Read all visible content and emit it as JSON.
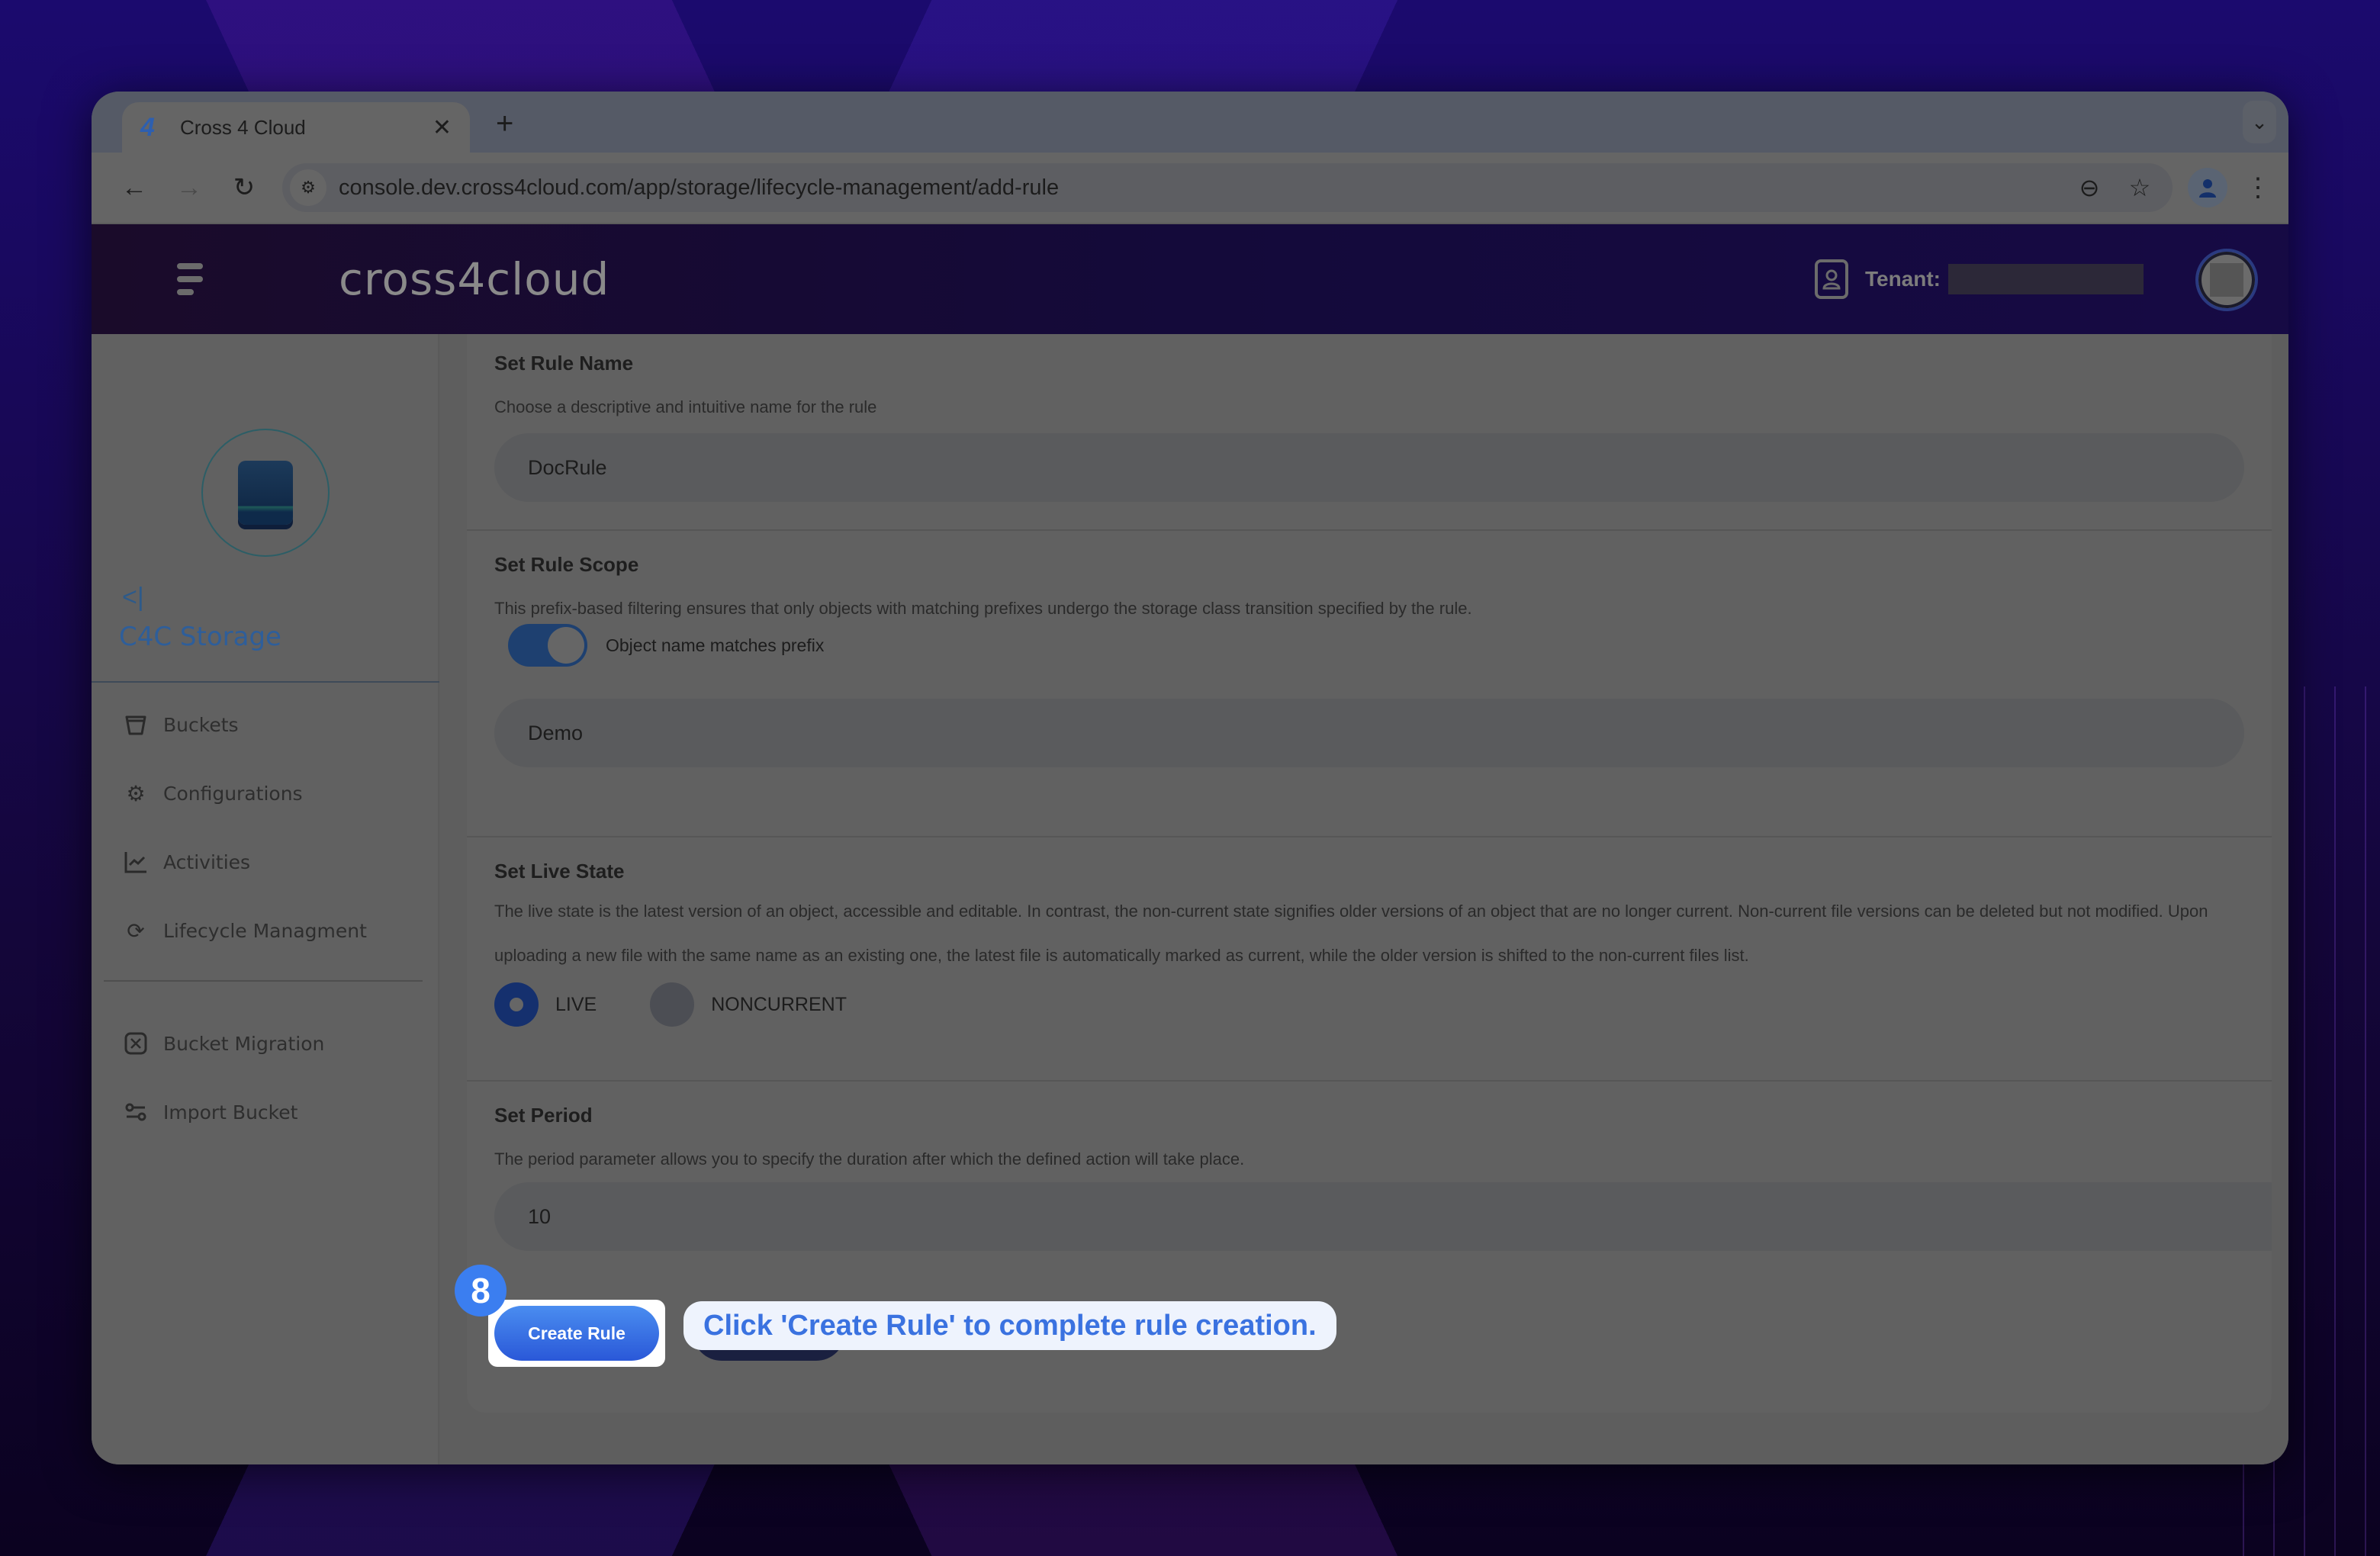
{
  "browser": {
    "tab_title": "Cross 4 Cloud",
    "tab_favicon": "4",
    "close_tab_glyph": "✕",
    "new_tab_glyph": "+",
    "tab_dropdown_glyph": "⌄",
    "back_glyph": "←",
    "forward_glyph": "→",
    "reload_glyph": "↻",
    "site_info_glyph": "⚙",
    "url": "console.dev.cross4cloud.com/app/storage/lifecycle-management/add-rule",
    "zoom_glyph": "⊖",
    "bookmark_glyph": "☆",
    "menu_glyph": "⋮"
  },
  "header": {
    "brand": "cross4cloud",
    "tenant_label": "Tenant:",
    "tenant_value": ""
  },
  "sidebar": {
    "module_title": "C4C Storage",
    "collapse_glyph": "<|",
    "items": [
      {
        "label": "Buckets",
        "icon": "bucket-icon",
        "glyph": "⛉"
      },
      {
        "label": "Configurations",
        "icon": "gear-icon",
        "glyph": "⚙"
      },
      {
        "label": "Activities",
        "icon": "chart-line-icon",
        "glyph": "📈"
      },
      {
        "label": "Lifecycle Managment",
        "icon": "refresh-icon",
        "glyph": "⟳"
      }
    ],
    "secondary_items": [
      {
        "label": "Bucket Migration",
        "icon": "migration-icon",
        "glyph": "⤧"
      },
      {
        "label": "Import Bucket",
        "icon": "sliders-icon",
        "glyph": "⚌"
      }
    ]
  },
  "form": {
    "rule_name": {
      "title": "Set Rule Name",
      "description": "Choose a descriptive and intuitive name for the rule",
      "value": "DocRule"
    },
    "rule_scope": {
      "title": "Set Rule Scope",
      "description": "This prefix-based filtering ensures that only objects with matching prefixes undergo the storage class transition specified by the rule.",
      "toggle_label": "Object name matches prefix",
      "toggle_on": true,
      "prefix_value": "Demo"
    },
    "live_state": {
      "title": "Set Live State",
      "description": "The live state is the latest version of an object, accessible and editable. In contrast, the non-current state signifies older versions of an object that are no longer current. Non-current file versions can be deleted but not modified. Upon uploading a new file with the same name as an existing one, the latest file is automatically marked as current, while the older version is shifted to the non-current files list.",
      "options": [
        {
          "label": "LIVE",
          "selected": true
        },
        {
          "label": "NONCURRENT",
          "selected": false
        }
      ]
    },
    "period": {
      "title": "Set Period",
      "description": "The period parameter allows you to specify the duration after which the defined action will take place.",
      "value": "10"
    },
    "create_button": "Create Rule"
  },
  "tutorial": {
    "step": "8",
    "tooltip": "Click 'Create Rule' to complete rule creation."
  },
  "colors": {
    "accent": "#3b7ef0",
    "tooltip_text": "#3a72e0",
    "module_title": "#2e5e9a"
  }
}
